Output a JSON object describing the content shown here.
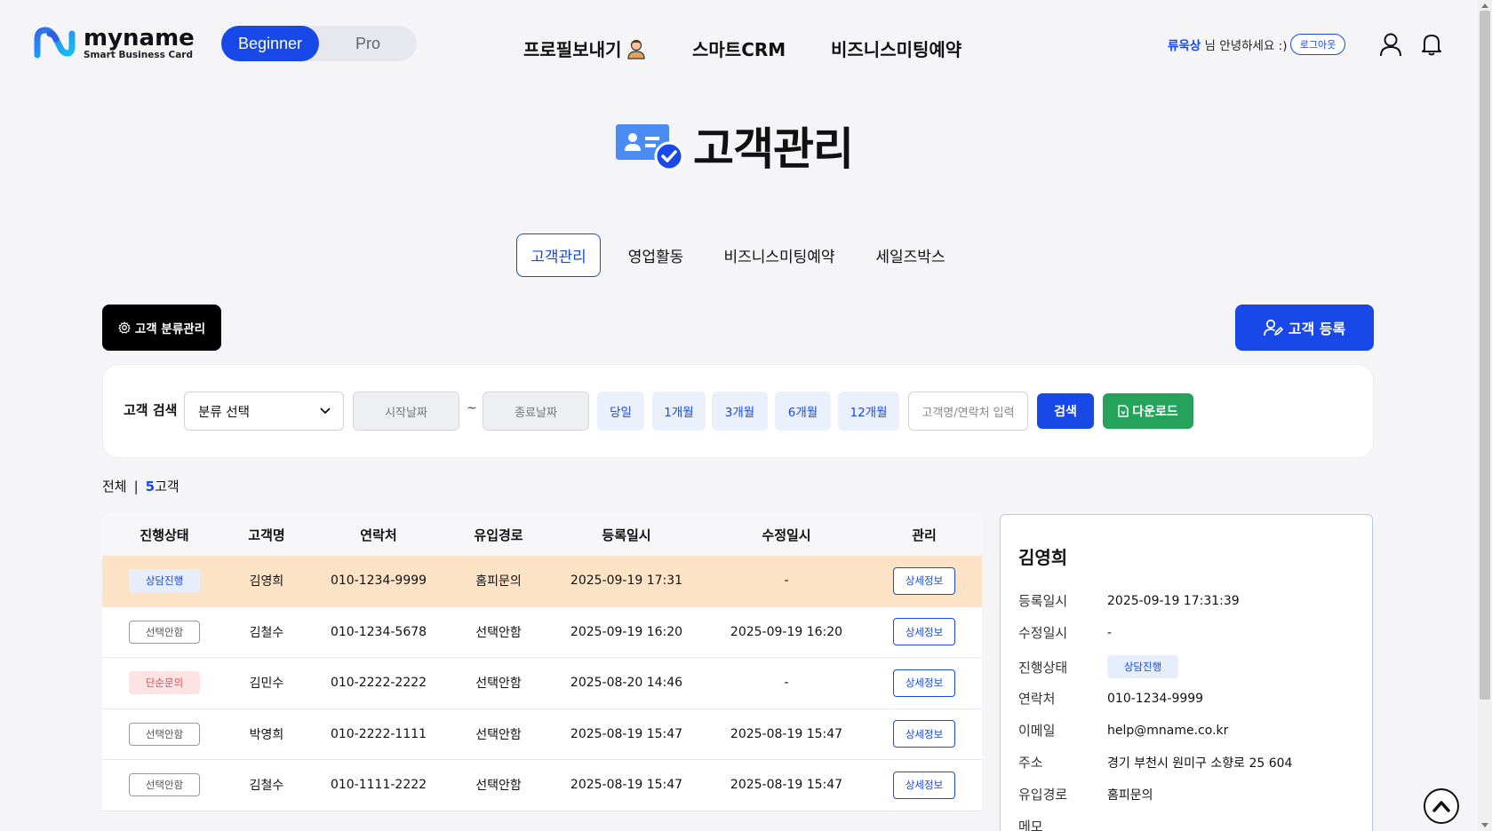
{
  "header": {
    "logo_main": "myname",
    "logo_sub": "Smart Business Card",
    "mode_beginner": "Beginner",
    "mode_pro": "Pro",
    "nav": [
      "프로필보내기",
      "스마트CRM",
      "비즈니스미팅예약"
    ],
    "user_name": "류욱상",
    "user_greeting_suffix": " 님 안녕하세요 :)",
    "logout_label": "로그아웃",
    "icons": [
      "user-icon",
      "bell-icon"
    ]
  },
  "page": {
    "title": "고객관리"
  },
  "tabs": [
    "고객관리",
    "영업활동",
    "비즈니스미팅예약",
    "세일즈박스"
  ],
  "actions": {
    "category_manage": "고객 분류관리",
    "register": "고객 등록"
  },
  "search": {
    "label": "고객 검색",
    "category_value": "분류 선택",
    "start_date_placeholder": "시작날짜",
    "tilde": "~",
    "end_date_placeholder": "종료날짜",
    "periods": [
      "당일",
      "1개월",
      "3개월",
      "6개월",
      "12개월"
    ],
    "keyword_placeholder": "고객명/연락처 입력",
    "search_label": "검색",
    "download_label": "다운로드"
  },
  "summary": {
    "all_label": "전체",
    "sep": "|",
    "count": "5",
    "unit": "고객"
  },
  "table": {
    "columns": [
      "진행상태",
      "고객명",
      "연락처",
      "유입경로",
      "등록일시",
      "수정일시",
      "관리"
    ],
    "detail_label": "상세정보",
    "rows": [
      {
        "status": "상담진행",
        "status_type": "blue",
        "name": "김영희",
        "phone": "010-1234-9999",
        "source": "홈피문의",
        "created": "2025-09-19 17:31",
        "modified": "-",
        "selected": true
      },
      {
        "status": "선택안함",
        "status_type": "gray",
        "name": "김철수",
        "phone": "010-1234-5678",
        "source": "선택안함",
        "created": "2025-09-19 16:20",
        "modified": "2025-09-19 16:20",
        "selected": false
      },
      {
        "status": "단순문의",
        "status_type": "red",
        "name": "김민수",
        "phone": "010-2222-2222",
        "source": "선택안함",
        "created": "2025-08-20 14:46",
        "modified": "-",
        "selected": false
      },
      {
        "status": "선택안함",
        "status_type": "gray",
        "name": "박영희",
        "phone": "010-2222-1111",
        "source": "선택안함",
        "created": "2025-08-19 15:47",
        "modified": "2025-08-19 15:47",
        "selected": false
      },
      {
        "status": "선택안함",
        "status_type": "gray",
        "name": "김철수",
        "phone": "010-1111-2222",
        "source": "선택안함",
        "created": "2025-08-19 15:47",
        "modified": "2025-08-19 15:47",
        "selected": false
      }
    ]
  },
  "detail": {
    "name": "김영희",
    "fields": [
      {
        "label": "등록일시",
        "value": "2025-09-19 17:31:39"
      },
      {
        "label": "수정일시",
        "value": "-"
      },
      {
        "label": "진행상태",
        "value": "상담진행",
        "badge": true
      },
      {
        "label": "연락처",
        "value": "010-1234-9999"
      },
      {
        "label": "이메일",
        "value": "help@mname.co.kr"
      },
      {
        "label": "주소",
        "value": "경기 부천시 원미구 소향로 25 604"
      },
      {
        "label": "유입경로",
        "value": "홈피문의"
      },
      {
        "label": "메모",
        "value": ""
      }
    ]
  },
  "colors": {
    "primary": "#1849e8",
    "selected_row": "#fde3c6",
    "download_green": "#25a35a"
  }
}
